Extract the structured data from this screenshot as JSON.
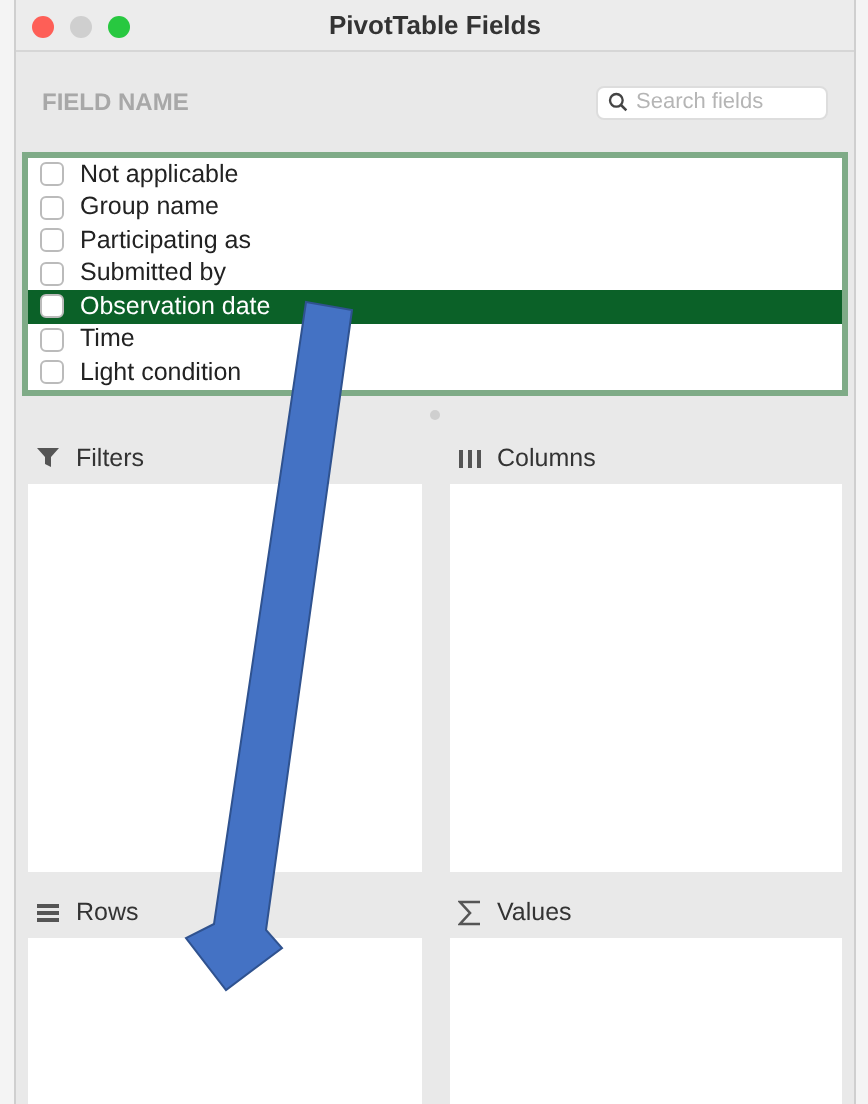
{
  "window": {
    "title": "PivotTable Fields"
  },
  "field_header": {
    "label": "FIELD NAME"
  },
  "search": {
    "placeholder": "Search fields"
  },
  "fields": [
    {
      "label": "Not applicable",
      "checked": false,
      "selected": false
    },
    {
      "label": "Group name",
      "checked": false,
      "selected": false
    },
    {
      "label": "Participating as",
      "checked": false,
      "selected": false
    },
    {
      "label": "Submitted by",
      "checked": false,
      "selected": false
    },
    {
      "label": "Observation date",
      "checked": false,
      "selected": true
    },
    {
      "label": "Time",
      "checked": false,
      "selected": false
    },
    {
      "label": "Light condition",
      "checked": false,
      "selected": false
    }
  ],
  "areas": [
    {
      "kind": "filter",
      "label": "Filters"
    },
    {
      "kind": "columns",
      "label": "Columns"
    },
    {
      "kind": "rows",
      "label": "Rows"
    },
    {
      "kind": "values",
      "label": "Values"
    }
  ]
}
